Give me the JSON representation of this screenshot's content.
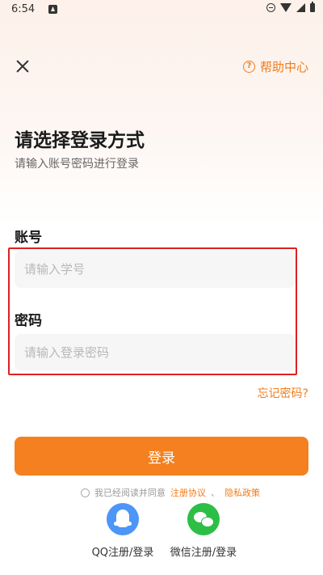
{
  "status": {
    "time": "6:54",
    "icons": [
      "notification-a-icon",
      "dnd-icon",
      "wifi-icon",
      "signal-icon",
      "battery-icon"
    ]
  },
  "header": {
    "close_icon": "close-icon",
    "help_label": "帮助中心",
    "help_icon_glyph": "?"
  },
  "main": {
    "title": "请选择登录方式",
    "subtitle": "请输入账号密码进行登录",
    "account_label": "账号",
    "account_placeholder": "请输入学号",
    "account_value": "",
    "password_label": "密码",
    "password_placeholder": "请输入登录密码",
    "password_value": "",
    "forgot_label": "忘记密码?",
    "login_label": "登录",
    "agreement": {
      "prefix": "我已经阅读并同意",
      "terms_link": "注册协议",
      "and": "、",
      "privacy_link": "隐私政策"
    }
  },
  "social": {
    "qq_label": "QQ注册/登录",
    "wechat_label": "微信注册/登录"
  },
  "colors": {
    "accent": "#f4801f",
    "highlight": "#e02020",
    "qq": "#4d95f7",
    "wechat": "#2dbe45"
  }
}
